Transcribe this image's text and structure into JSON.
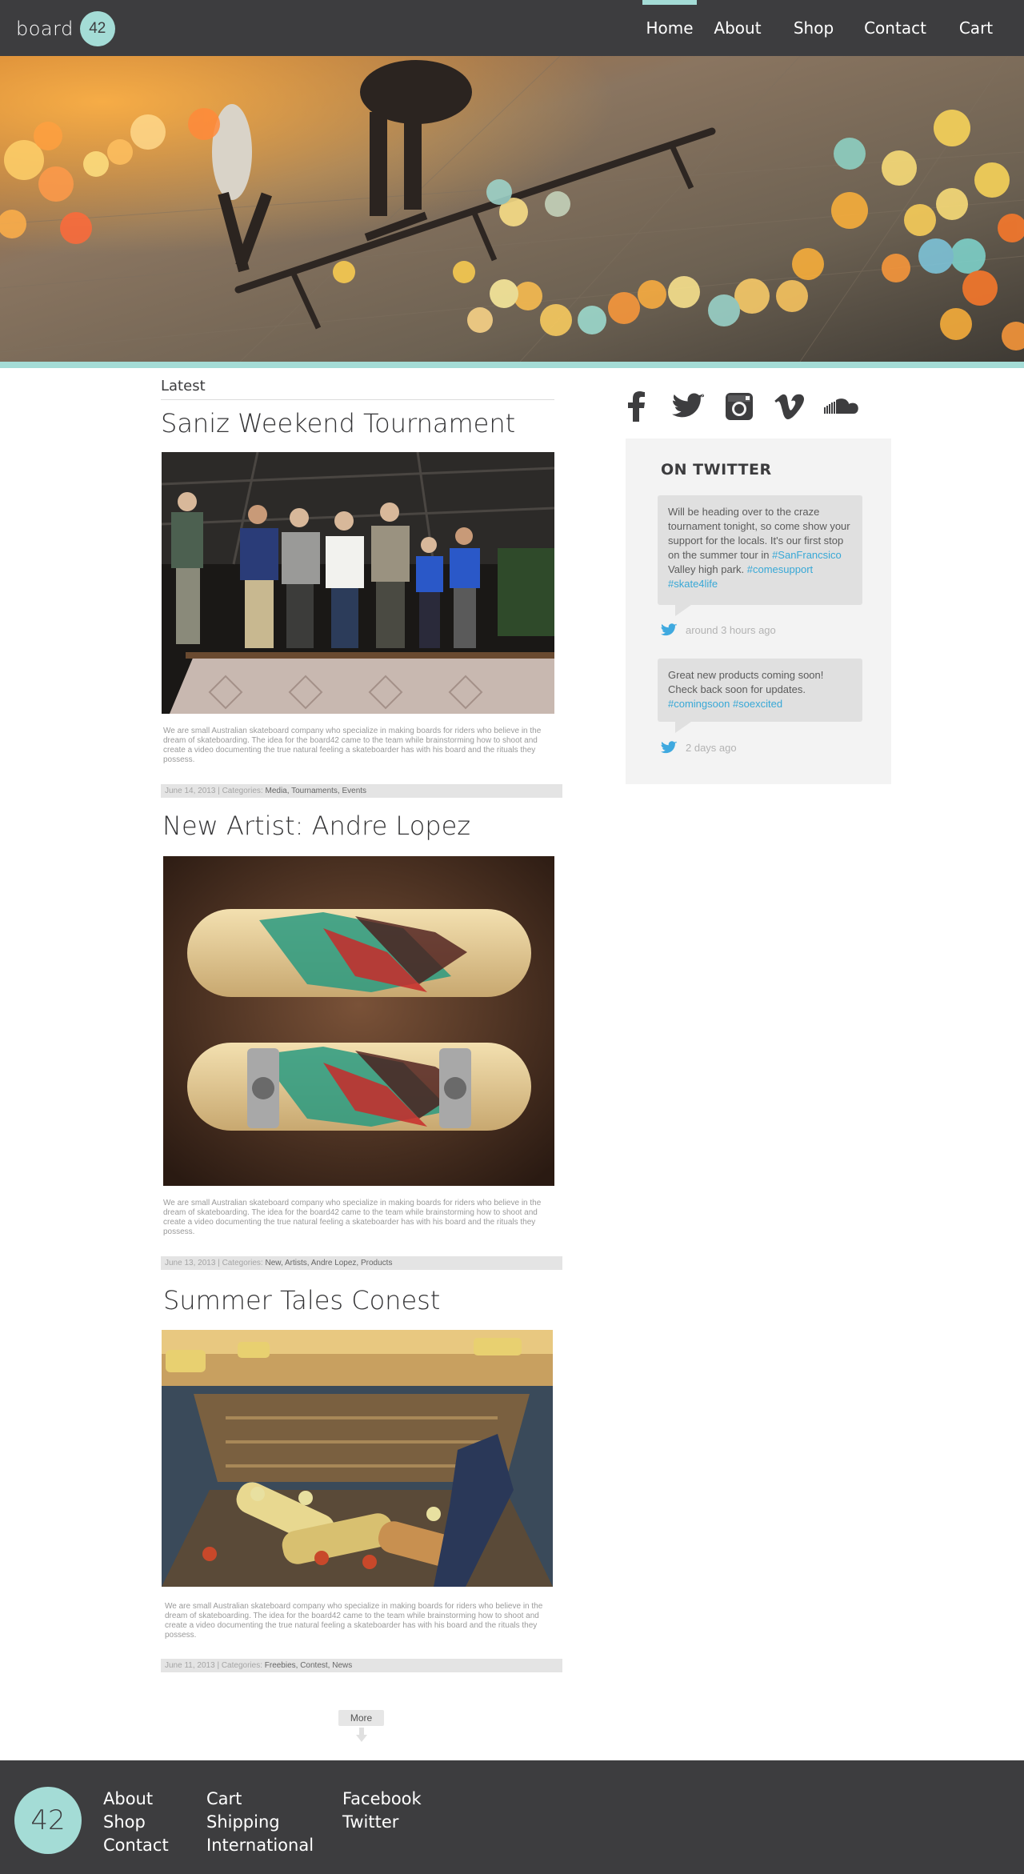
{
  "nav": {
    "brand_word": "board",
    "brand_badge": "42",
    "items": [
      {
        "label": "Home",
        "active": true
      },
      {
        "label": "About"
      },
      {
        "label": "Shop"
      },
      {
        "label": "Contact"
      },
      {
        "label": "Cart"
      }
    ]
  },
  "main": {
    "section_title": "Latest",
    "posts": [
      {
        "title": "Saniz Weekend Tournament",
        "image": "skaters-on-ramp-photo",
        "body": "We are small Australian skateboard company who specialize in making boards for riders who believe in the dream of skateboarding. The idea for the board42 came to the team while brainstorming how to shoot and create a video documenting the true natural feeling a skateboarder has with his board and the rituals they possess.",
        "date": "June 14, 2013",
        "categories_label": "Categories:",
        "categories": "Media, Tournaments, Events"
      },
      {
        "title": "New Artist: Andre Lopez",
        "image": "skateboard-decks-artwork",
        "body": "We are small Australian skateboard company who specialize in making boards for riders who believe in the dream of skateboarding. The idea for the board42 came to the team while brainstorming how to shoot and create a video documenting the true natural feeling a skateboarder has with his board and the rituals they possess.",
        "date": "June 13, 2013",
        "categories_label": "Categories:",
        "categories": "New, Artists, Andre Lopez, Products"
      },
      {
        "title": "Summer Tales Conest",
        "image": "boards-in-truck-bed-photo",
        "body": "We are small Australian skateboard company who specialize in making boards for riders who believe in the dream of skateboarding. The idea for the board42 came to the team while brainstorming how to shoot and create a video documenting the true natural feeling a skateboarder has with his board and the rituals they possess.",
        "date": "June 11, 2013",
        "categories_label": "Categories:",
        "categories": "Freebies, Contest, News"
      }
    ],
    "more_label": "More"
  },
  "sidebar": {
    "social_icons": [
      "facebook-icon",
      "twitter-icon",
      "instagram-icon",
      "vimeo-icon",
      "soundcloud-icon"
    ],
    "twitter_title": "ON TWITTER",
    "tweets": [
      {
        "text_before": "Will be heading over to the craze tournament tonight, so come show your support for the locals. It's our first stop on the summer tour in ",
        "tag1": "#SanFrancsico",
        "text_mid": " Valley high park. ",
        "tag2": "#comesupport",
        "tag3": "#skate4life",
        "time": "around 3 hours ago"
      },
      {
        "text_before": "Great new products coming soon! Check back soon for updates. ",
        "tag1": "#comingsoon",
        "tag2": "#soexcited",
        "time": "2 days ago"
      }
    ]
  },
  "footer": {
    "badge": "42",
    "col1": [
      "About",
      "Shop",
      "Contact"
    ],
    "col2": [
      "Cart",
      "Shipping",
      "International"
    ],
    "col3": [
      "Facebook",
      "Twitter"
    ]
  },
  "colors": {
    "nav_bg": "#3d3d3f",
    "accent": "#a4dcd6",
    "link": "#38a8d6",
    "panel": "#f3f3f3"
  }
}
